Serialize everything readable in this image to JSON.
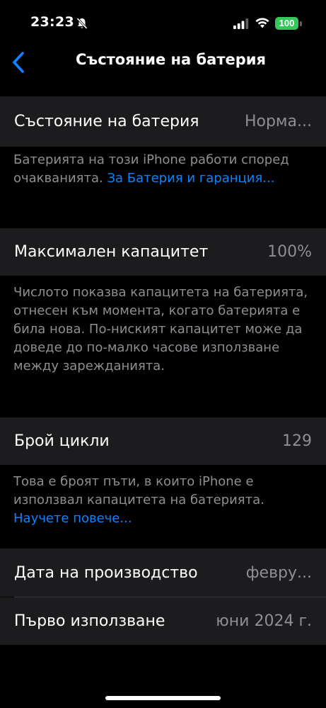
{
  "status_bar": {
    "time": "23:23",
    "battery_level": "100"
  },
  "nav": {
    "title": "Състояние на батерия"
  },
  "battery_health": {
    "label": "Състояние на батерия",
    "value": "Норма...",
    "footer_text": "Батерията на този iPhone работи според очакванията. ",
    "footer_link": "За Батерия и гаранция..."
  },
  "max_capacity": {
    "label": "Максимален капацитет",
    "value": "100%",
    "footer_text": "Числото показва капацитета на батерията, отнесен към момента, когато батерията е била нова. По-ниският капацитет може да доведе до по-малко часове използване между зарежданията."
  },
  "cycle_count": {
    "label": "Брой цикли",
    "value": "129",
    "footer_text": "Това е броят пъти, в които iPhone е използвал капацитета на батерията. ",
    "footer_link": "Научете повече..."
  },
  "manufacture_date": {
    "label": "Дата на производство",
    "value": "февру..."
  },
  "first_use": {
    "label": "Първо използване",
    "value": "юни 2024 г."
  },
  "colors": {
    "background": "#000000",
    "cell": "#1c1c1e",
    "secondary_text": "#8e8e93",
    "link": "#0a84ff",
    "battery": "#34c759"
  }
}
